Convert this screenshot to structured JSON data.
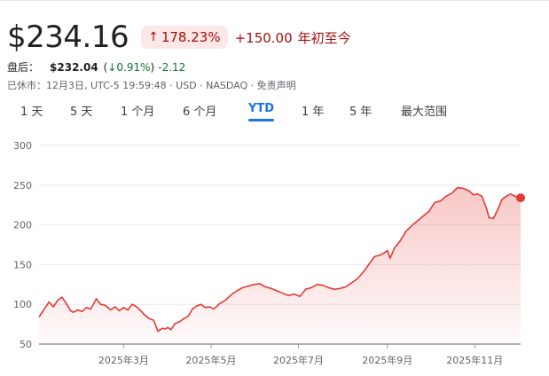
{
  "quote": {
    "price": "$234.16",
    "change_pct": "178.23%",
    "change_abs": "+150.00",
    "period": "年初至今",
    "up_color": "#a50e0e"
  },
  "after_hours": {
    "label": "盘后：",
    "price": "$232.04",
    "pct_open": "(",
    "pct": "0.91%",
    "pct_close": ")",
    "abs": "-2.12"
  },
  "status": "已休市：12月3日, UTC-5 19:59:48 · USD · NASDAQ · 免责声明",
  "tabs": [
    {
      "label": "1 天"
    },
    {
      "label": "5 天"
    },
    {
      "label": "1 个月"
    },
    {
      "label": "6 个月"
    },
    {
      "label": "YTD",
      "active": true
    },
    {
      "label": "1 年"
    },
    {
      "label": "5 年"
    },
    {
      "label": "最大范围"
    }
  ],
  "chart_data": {
    "type": "area",
    "title": "",
    "xlabel": "",
    "ylabel": "",
    "ylim": [
      50,
      300
    ],
    "yticks": [
      50,
      100,
      150,
      200,
      250,
      300
    ],
    "grid": true,
    "line_color": "#e53935",
    "x_tick_labels": [
      "2025年3月",
      "2025年5月",
      "2025年7月",
      "2025年9月",
      "2025年11月"
    ],
    "x_tick_days": [
      59,
      120,
      181,
      243,
      304
    ],
    "x_range_days": [
      0,
      336
    ],
    "series": [
      {
        "x": [
          0,
          4,
          7,
          10,
          13,
          16,
          19,
          22,
          24,
          27,
          30,
          33,
          36,
          40,
          43,
          46,
          50,
          53,
          56,
          59,
          62,
          65,
          68,
          71,
          74,
          77,
          80,
          83,
          86,
          88,
          90,
          92,
          95,
          98,
          101,
          104,
          107,
          110,
          113,
          116,
          119,
          122,
          126,
          130,
          134,
          138,
          142,
          146,
          150,
          154,
          158,
          162,
          166,
          170,
          174,
          178,
          182,
          186,
          190,
          194,
          198,
          202,
          206,
          210,
          214,
          218,
          222,
          226,
          230,
          234,
          238,
          241,
          243,
          245,
          248,
          252,
          256,
          260,
          264,
          268,
          272,
          276,
          280,
          284,
          288,
          292,
          296,
          300,
          303,
          306,
          309,
          312,
          314,
          317,
          320,
          323,
          326,
          329,
          332,
          336
        ],
        "values": [
          84,
          95,
          103,
          97,
          105,
          109,
          101,
          92,
          90,
          93,
          91,
          96,
          94,
          107,
          100,
          99,
          93,
          97,
          92,
          96,
          93,
          100,
          97,
          92,
          86,
          82,
          80,
          66,
          70,
          69,
          71,
          68,
          76,
          78,
          82,
          85,
          94,
          98,
          100,
          96,
          97,
          94,
          101,
          105,
          112,
          117,
          121,
          123,
          125,
          126,
          122,
          120,
          117,
          114,
          111,
          113,
          110,
          119,
          121,
          125,
          124,
          121,
          119,
          120,
          122,
          127,
          132,
          140,
          150,
          160,
          162,
          165,
          168,
          158,
          171,
          180,
          192,
          199,
          205,
          211,
          217,
          228,
          230,
          236,
          240,
          247,
          246,
          243,
          238,
          239,
          236,
          222,
          209,
          208,
          219,
          232,
          236,
          239,
          236,
          234
        ]
      }
    ]
  }
}
